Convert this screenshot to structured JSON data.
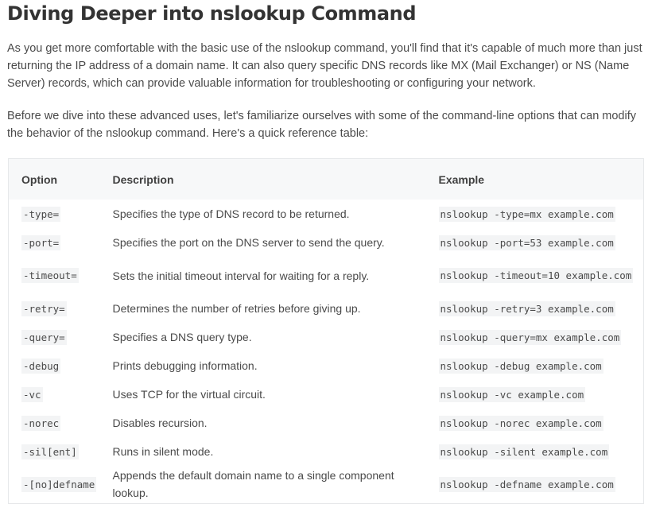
{
  "article": {
    "heading": "Diving Deeper into nslookup Command",
    "paragraphs": [
      "As you get more comfortable with the basic use of the nslookup command, you'll find that it's capable of much more than just returning the IP address of a domain name. It can also query specific DNS records like MX (Mail Exchanger) or NS (Name Server) records, which can provide valuable information for troubleshooting or configuring your network.",
      "Before we dive into these advanced uses, let's familiarize ourselves with some of the command-line options that can modify the behavior of the nslookup command. Here's a quick reference table:"
    ]
  },
  "table": {
    "headers": [
      "Option",
      "Description",
      "Example"
    ],
    "rows": [
      {
        "option": "-type=",
        "description": "Specifies the type of DNS record to be returned.",
        "example": "nslookup -type=mx example.com"
      },
      {
        "option": "-port=",
        "description": "Specifies the port on the DNS server to send the query.",
        "example": "nslookup -port=53 example.com"
      },
      {
        "option": "-timeout=",
        "description": "Sets the initial timeout interval for waiting for a reply.",
        "example": "nslookup -timeout=10 example.com"
      },
      {
        "option": "-retry=",
        "description": "Determines the number of retries before giving up.",
        "example": "nslookup -retry=3 example.com"
      },
      {
        "option": "-query=",
        "description": "Specifies a DNS query type.",
        "example": "nslookup -query=mx example.com"
      },
      {
        "option": "-debug",
        "description": "Prints debugging information.",
        "example": "nslookup -debug example.com"
      },
      {
        "option": "-vc",
        "description": "Uses TCP for the virtual circuit.",
        "example": "nslookup -vc example.com"
      },
      {
        "option": "-norec",
        "description": "Disables recursion.",
        "example": "nslookup -norec example.com"
      },
      {
        "option": "-sil[ent]",
        "description": "Runs in silent mode.",
        "example": "nslookup -silent example.com"
      },
      {
        "option": "-[no]defname",
        "description": "Appends the default domain name to a single component lookup.",
        "example": "nslookup -defname example.com"
      }
    ]
  }
}
